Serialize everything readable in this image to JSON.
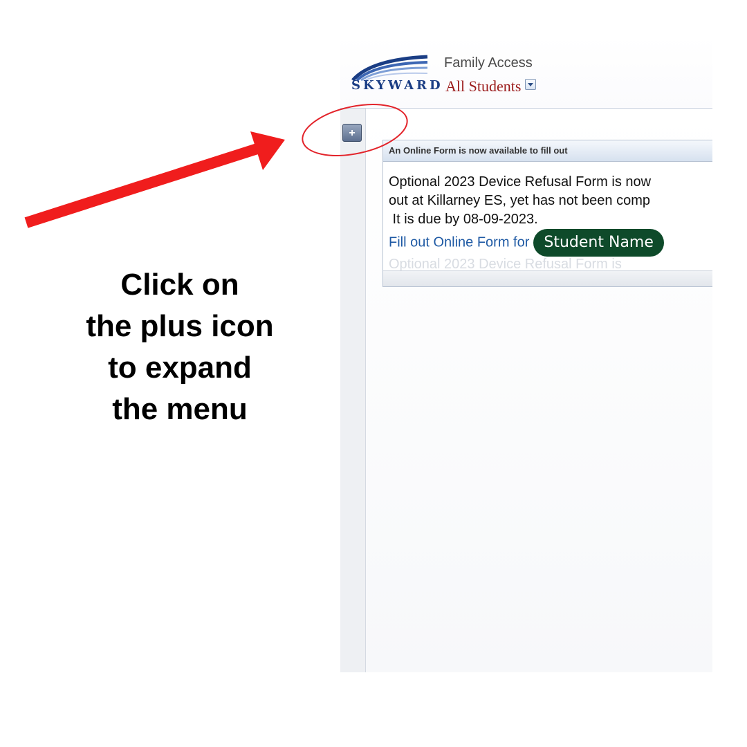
{
  "header": {
    "logo_text": "SKYWARD",
    "app_title": "Family Access",
    "student_selector": "All Students"
  },
  "sidebar": {
    "expand_button_label": "+"
  },
  "notification": {
    "title": "An Online Form is now available to fill out",
    "line1": "Optional 2023 Device Refusal Form is now",
    "line2": "out at Killarney ES, yet has not been comp",
    "line3": " It is due by 08-09-2023.",
    "link_text": "Fill out Online Form for",
    "student_name": "Student Name",
    "faded_text": "Optional 2023 Device Refusal Form is"
  },
  "instruction": {
    "line1": "Click on",
    "line2": "the plus icon",
    "line3": "to expand",
    "line4": "the menu"
  },
  "colors": {
    "arrow": "#f01d1d",
    "circle": "#e3242b",
    "student_pill": "#0e4a2a",
    "link": "#1f5aa4",
    "student_selector": "#9b1b1b"
  }
}
